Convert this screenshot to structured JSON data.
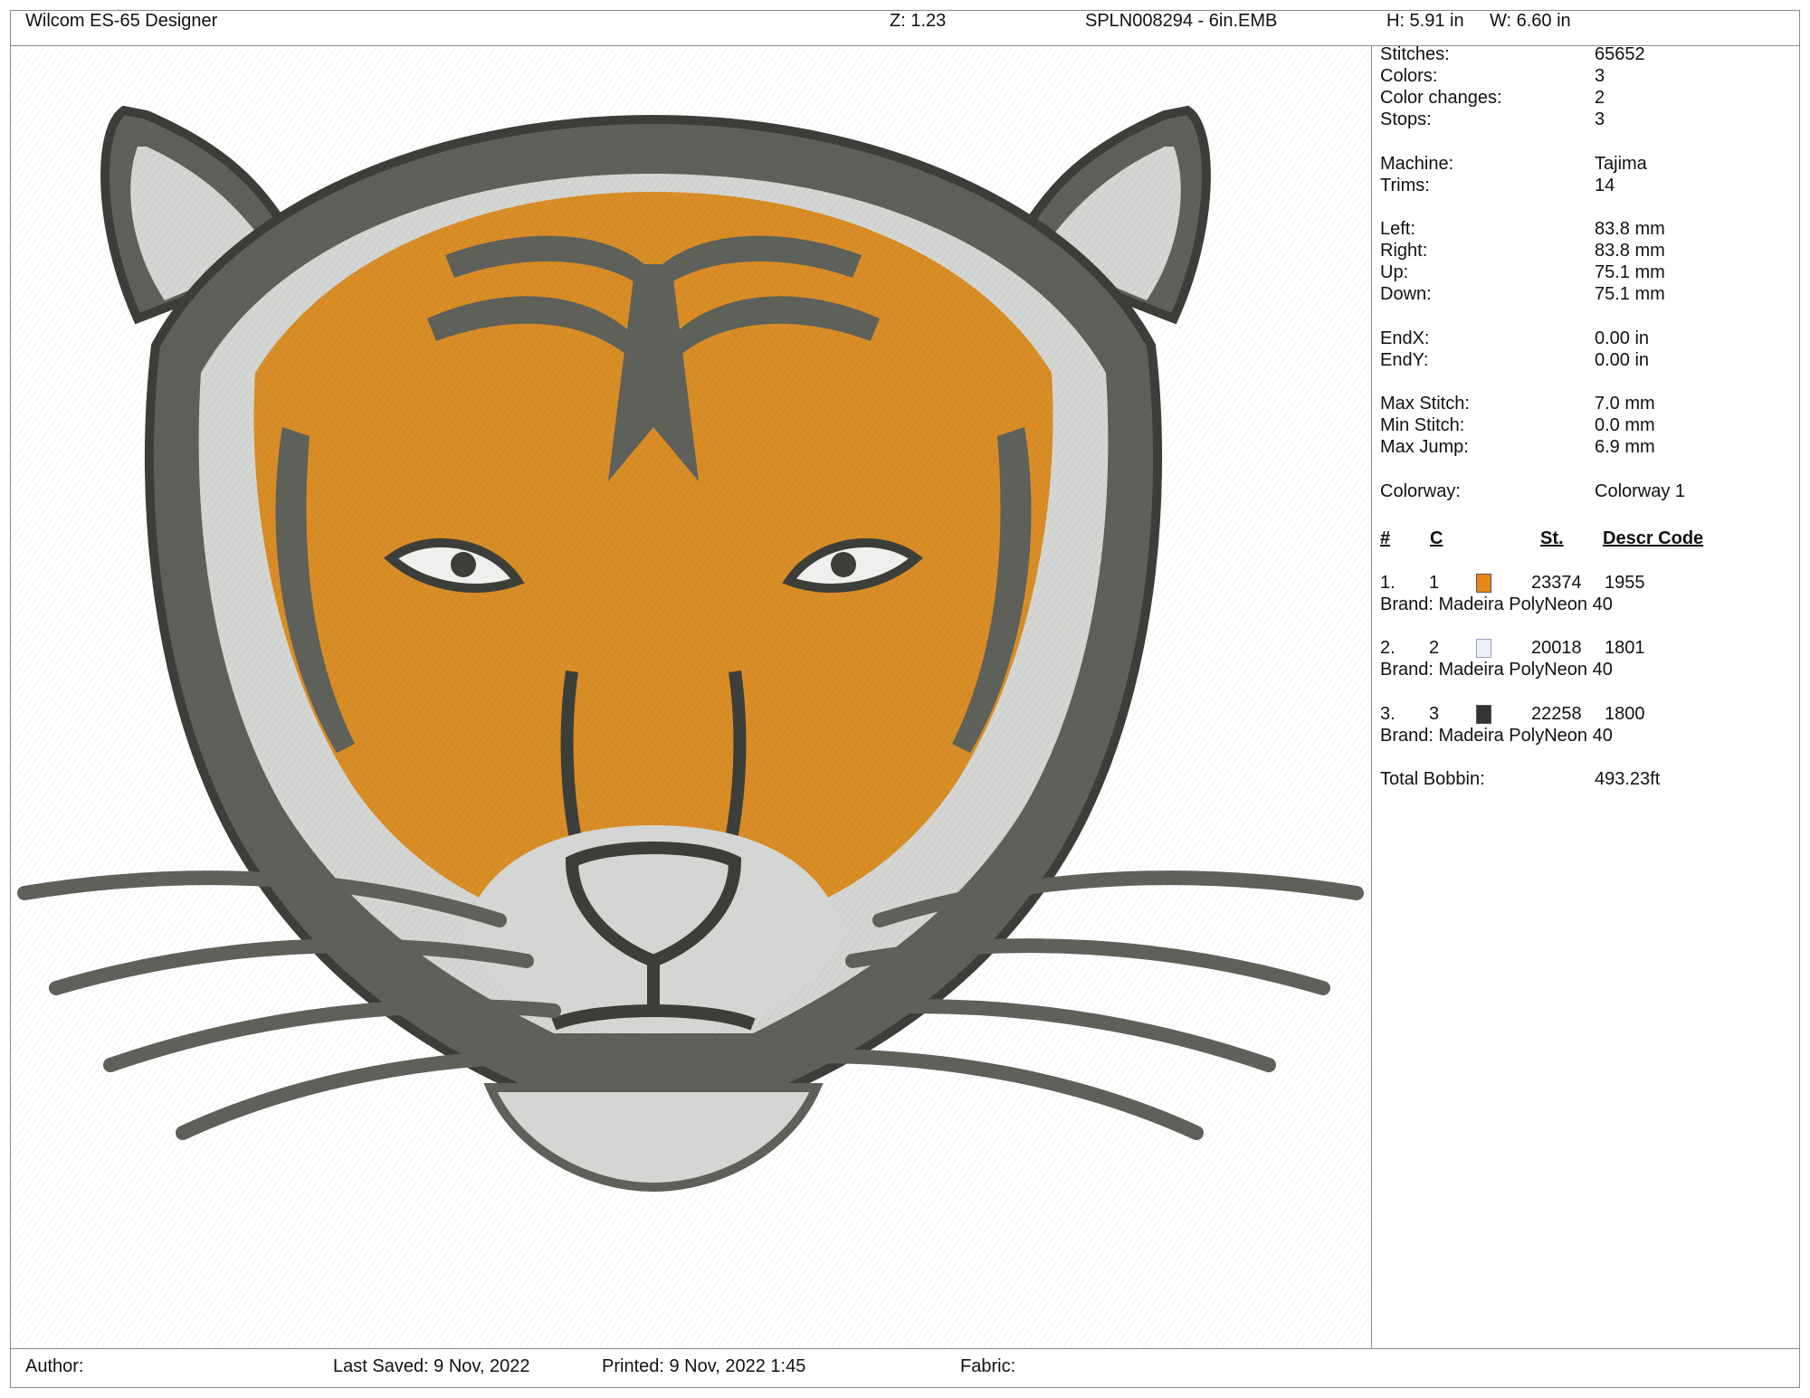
{
  "header": {
    "app_title": "Wilcom ES-65 Designer",
    "zoom": "Z: 1.23",
    "filename": "SPLN008294 - 6in.EMB",
    "height": "H: 5.91 in",
    "width": "W: 6.60 in"
  },
  "stats": [
    {
      "label": "Stitches:",
      "value": "65652"
    },
    {
      "label": "Colors:",
      "value": "3"
    },
    {
      "label": "Color changes:",
      "value": "2"
    },
    {
      "label": "Stops:",
      "value": "3"
    },
    {
      "label": "Machine:",
      "value": "Tajima"
    },
    {
      "label": "Trims:",
      "value": "14"
    },
    {
      "label": "Left:",
      "value": "83.8 mm"
    },
    {
      "label": "Right:",
      "value": "83.8 mm"
    },
    {
      "label": "Up:",
      "value": "75.1 mm"
    },
    {
      "label": "Down:",
      "value": "75.1 mm"
    },
    {
      "label": "EndX:",
      "value": "0.00 in"
    },
    {
      "label": "EndY:",
      "value": "0.00 in"
    },
    {
      "label": "Max Stitch:",
      "value": "7.0 mm"
    },
    {
      "label": "Min Stitch:",
      "value": "0.0 mm"
    },
    {
      "label": "Max Jump:",
      "value": "6.9 mm"
    },
    {
      "label": "Colorway:",
      "value": "Colorway 1"
    }
  ],
  "color_table": {
    "headers": {
      "num": "#",
      "color": "C",
      "stitches": "St.",
      "descr_code": "Descr  Code"
    },
    "rows": [
      {
        "index": "1.",
        "color_no": "1",
        "swatch": "#e8861a",
        "stitches": "23374",
        "code": "1955",
        "brand": "Brand: Madeira PolyNeon 40"
      },
      {
        "index": "2.",
        "color_no": "2",
        "swatch": "#eceef8",
        "stitches": "20018",
        "code": "1801",
        "brand": "Brand: Madeira PolyNeon 40"
      },
      {
        "index": "3.",
        "color_no": "3",
        "swatch": "#333333",
        "stitches": "22258",
        "code": "1800",
        "brand": "Brand: Madeira PolyNeon 40"
      }
    ]
  },
  "total_bobbin": {
    "label": "Total Bobbin:",
    "value": "493.23ft"
  },
  "footer": {
    "author": "Author:",
    "last_saved": "Last Saved:  9 Nov, 2022",
    "printed": "Printed:  9 Nov, 2022  1:45",
    "fabric": "Fabric:"
  },
  "design": {
    "subject": "tiger-head",
    "colors": {
      "orange": "#d98d26",
      "light": "#d4d6d3",
      "dark": "#5e605a",
      "outline": "#3c3e39"
    }
  }
}
